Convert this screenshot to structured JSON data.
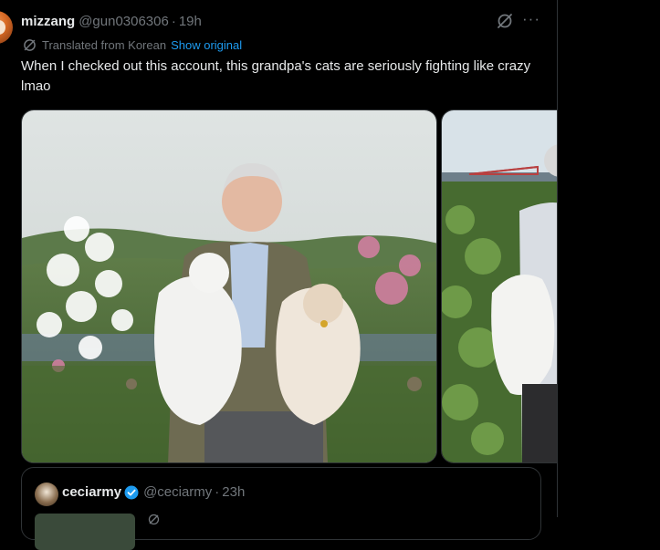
{
  "tweet": {
    "author_name": "mizzang",
    "handle": "@gun0306306",
    "separator": "·",
    "time": "19h",
    "translated_label": "Translated from Korean",
    "show_original": "Show original",
    "text": "When I checked out this account, this grandpa's cats are seriously fighting like crazy lmao",
    "more_glyph": "···",
    "icons": [
      "globe-icon",
      "grok-icon",
      "more-icon"
    ]
  },
  "quote": {
    "author_name": "ceciarmy",
    "handle": "@ceciarmy",
    "separator": "·",
    "time": "23h",
    "verified_color": "#1d9bf0"
  },
  "colors": {
    "background": "#000000",
    "text_primary": "#e7e9ea",
    "text_secondary": "#71767b",
    "link": "#1d9bf0",
    "border": "#2f3336"
  }
}
